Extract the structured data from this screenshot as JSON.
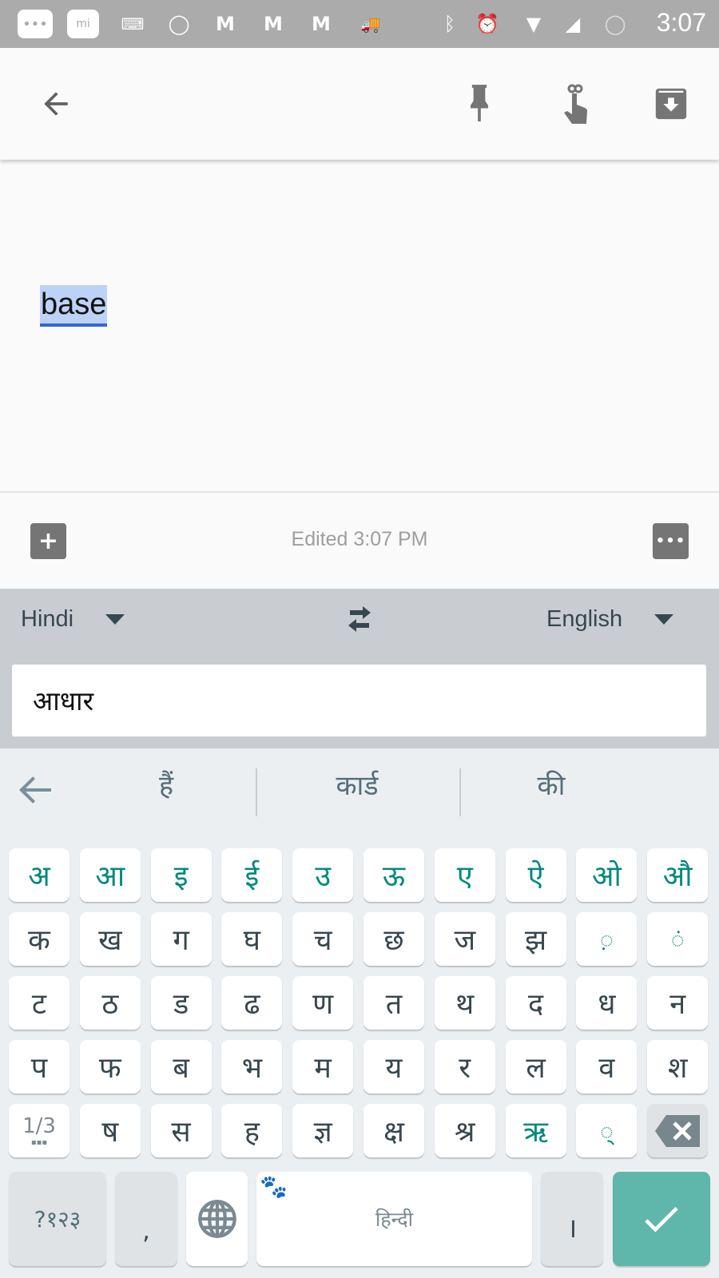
{
  "status_bar": {
    "time": "3:07",
    "icons": [
      "messages-icon",
      "mi-icon",
      "keyboard-icon",
      "whatsapp-icon",
      "gmail-icon",
      "myntra-icon",
      "myntra-icon",
      "delivery-truck-icon",
      "bluetooth-icon",
      "alarm-icon",
      "wifi-icon",
      "signal-icon",
      "battery-icon"
    ]
  },
  "toolbar": {
    "icons": [
      "back-arrow-icon",
      "pin-icon",
      "reminder-icon",
      "archive-icon"
    ]
  },
  "note": {
    "text": "base"
  },
  "bottom_bar": {
    "edited": "Edited 3:07 PM",
    "icons": [
      "add-box-icon",
      "more-icon"
    ]
  },
  "translate": {
    "source_lang": "Hindi",
    "target_lang": "English",
    "input": "आधार",
    "icons": [
      "dropdown-icon",
      "swap-icon"
    ]
  },
  "suggestions": {
    "items": [
      "हैं",
      "कार्ड",
      "की"
    ],
    "icons": [
      "back-arrow-icon"
    ]
  },
  "keyboard": {
    "colors": {
      "vowel": "#00897b",
      "consonant": "#37474f",
      "enter": "#5fb6aa"
    },
    "rows": [
      [
        "अ",
        "आ",
        "इ",
        "ई",
        "उ",
        "ऊ",
        "ए",
        "ऐ",
        "ओ",
        "औ"
      ],
      [
        "क",
        "ख",
        "ग",
        "घ",
        "च",
        "छ",
        "ज",
        "झ",
        "◌़",
        "◌ं"
      ],
      [
        "ट",
        "ठ",
        "ड",
        "ढ",
        "ण",
        "त",
        "थ",
        "द",
        "ध",
        "न"
      ],
      [
        "प",
        "फ",
        "ब",
        "भ",
        "म",
        "य",
        "र",
        "ल",
        "व",
        "श"
      ],
      [
        "ष",
        "स",
        "ह",
        "ज्ञ",
        "क्ष",
        "श्र",
        "ऋ",
        "◌्"
      ]
    ],
    "page_key": "1/3",
    "symbols_key": "?१२३",
    "comma_key": ",",
    "space_label": "हिन्दी",
    "danda_key": "।",
    "icons": [
      "backspace-icon",
      "globe-icon",
      "paw-icon",
      "checkmark-icon"
    ]
  }
}
